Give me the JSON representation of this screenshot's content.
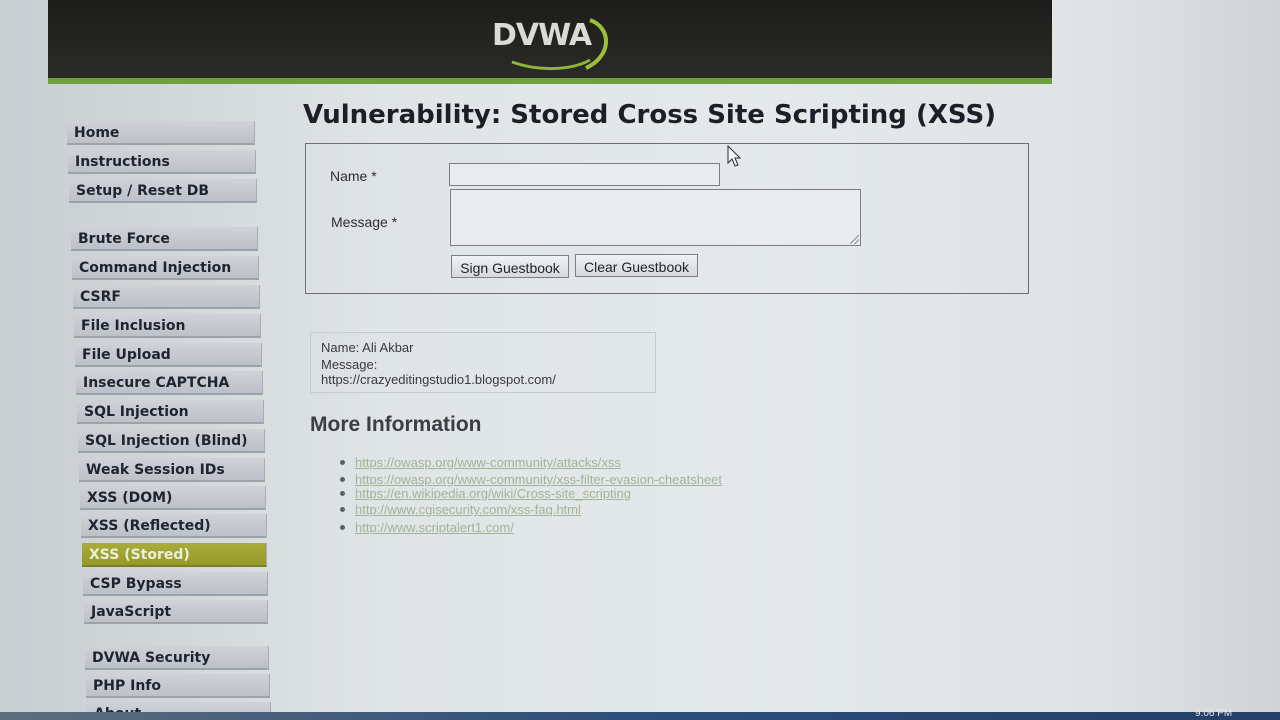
{
  "header": {
    "logo_text": "DVWA"
  },
  "sidebar": {
    "items": [
      {
        "label": "Home"
      },
      {
        "label": "Instructions"
      },
      {
        "label": "Setup / Reset DB"
      },
      {
        "label": "Brute Force"
      },
      {
        "label": "Command Injection"
      },
      {
        "label": "CSRF"
      },
      {
        "label": "File Inclusion"
      },
      {
        "label": "File Upload"
      },
      {
        "label": "Insecure CAPTCHA"
      },
      {
        "label": "SQL Injection"
      },
      {
        "label": "SQL Injection (Blind)"
      },
      {
        "label": "Weak Session IDs"
      },
      {
        "label": "XSS (DOM)"
      },
      {
        "label": "XSS (Reflected)"
      },
      {
        "label": "XSS (Stored)",
        "selected": true
      },
      {
        "label": "CSP Bypass"
      },
      {
        "label": "JavaScript"
      },
      {
        "label": "DVWA Security"
      },
      {
        "label": "PHP Info"
      },
      {
        "label": "About"
      }
    ]
  },
  "main": {
    "title": "Vulnerability: Stored Cross Site Scripting (XSS)",
    "form": {
      "name_label": "Name *",
      "name_value": "",
      "message_label": "Message *",
      "message_value": "",
      "sign_button": "Sign Guestbook",
      "clear_button": "Clear Guestbook"
    },
    "entry": {
      "name_line": "Name: Ali Akbar",
      "message_label": "Message:",
      "message_text": "https://crazyeditingstudio1.blogspot.com/"
    },
    "more_info": {
      "title": "More Information",
      "links": [
        "https://owasp.org/www-community/attacks/xss",
        "https://owasp.org/www-community/xss-filter-evasion-cheatsheet",
        "https://en.wikipedia.org/wiki/Cross-site_scripting",
        "http://www.cgisecurity.com/xss-faq.html",
        "http://www.scriptalert1.com/"
      ]
    }
  },
  "taskbar": {
    "clock": "9:06 PM"
  },
  "colors": {
    "header_bg": "#1c1c1a",
    "header_accent": "#6da23a",
    "menu_bg": "#c4c8cf",
    "menu_selected": "#a1a433",
    "link": "#a3b396"
  },
  "icons": [
    "dvwa-logo",
    "mouse-pointer-icon",
    "resize-grip-icon"
  ]
}
